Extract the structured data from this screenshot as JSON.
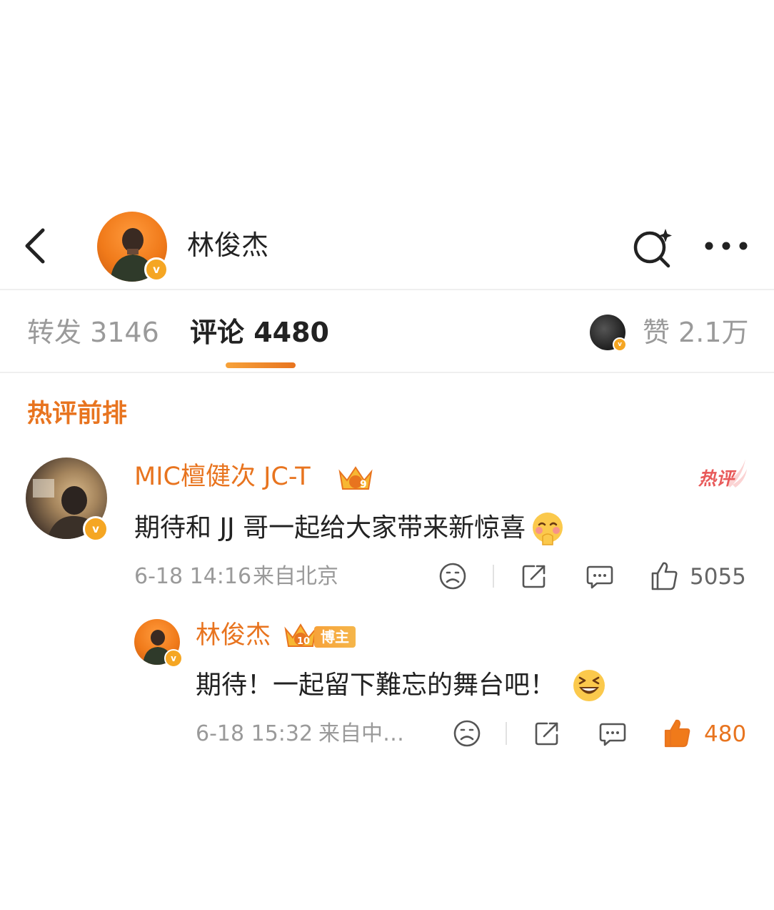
{
  "header": {
    "title": "林俊杰",
    "back_icon": "chevron-left-icon",
    "search_icon": "search-sparkle-icon",
    "more_icon": "ellipsis-icon"
  },
  "tabs": {
    "repost": "转发 3146",
    "comment": "评论 4480",
    "like": "赞 2.1万"
  },
  "section_title": "热评前排",
  "comments": [
    {
      "username": "MIC檀健次 JC-T",
      "badge_level": "9",
      "hot_label": "热评",
      "text": "期待和 JJ 哥一起给大家带来新惊喜",
      "time": "6-18 14:16",
      "location": "来自北京",
      "likes": "5055",
      "liked": false
    },
    {
      "username": "林俊杰",
      "badge_level": "10",
      "role_label": "博主",
      "text": "期待！一起留下難忘的舞台吧！",
      "time": "6-18 15:32",
      "location": "来自中…",
      "likes": "480",
      "liked": true
    }
  ],
  "colors": {
    "accent": "#e8741f",
    "gray": "#9a9a9a",
    "verified": "#f5a623"
  }
}
